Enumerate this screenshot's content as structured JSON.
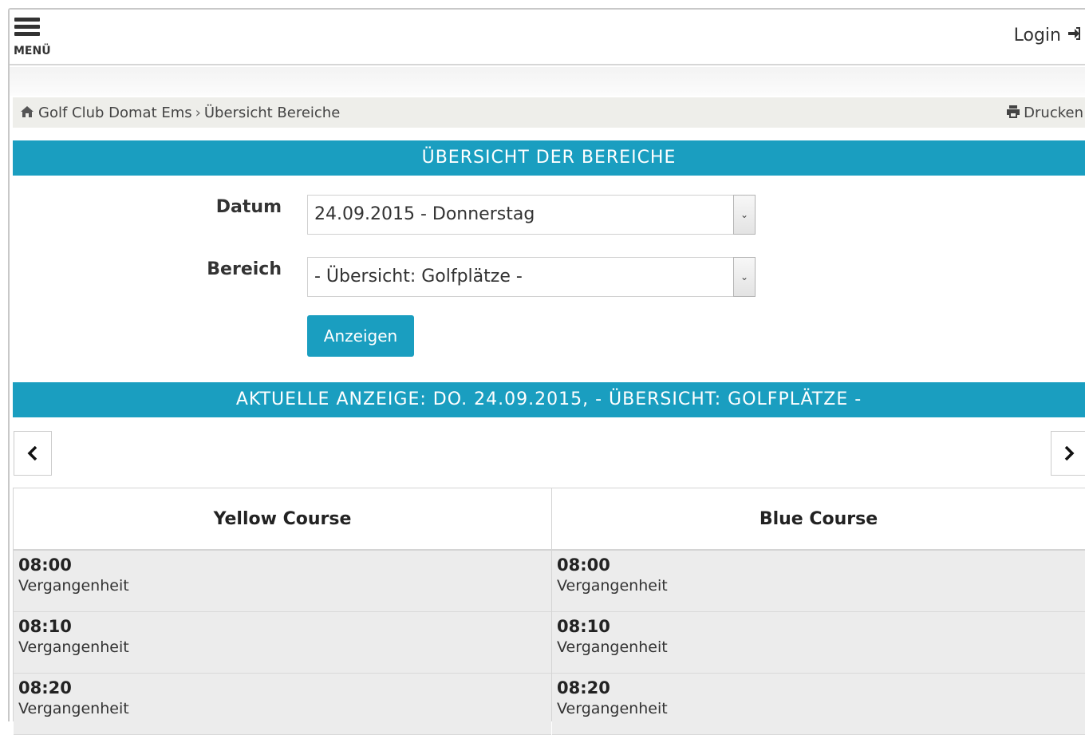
{
  "topbar": {
    "menu_label": "MENÜ",
    "login_label": "Login",
    "login_icon": "➜"
  },
  "breadcrumb": {
    "home": "Golf Club Domat Ems",
    "separator": "›",
    "current": "Übersicht Bereiche",
    "print_label": "Drucken"
  },
  "overview": {
    "header": "ÜBERSICHT DER BEREICHE",
    "date_label": "Datum",
    "date_value": "24.09.2015 - Donnerstag",
    "area_label": "Bereich",
    "area_value": "- Übersicht: Golfplätze -",
    "show_button": "Anzeigen"
  },
  "current_display": {
    "header": "AKTUELLE ANZEIGE: DO. 24.09.2015, - ÜBERSICHT: GOLFPLÄTZE -",
    "prev": "‹",
    "next": "›"
  },
  "courses": [
    {
      "name": "Yellow Course",
      "slots": [
        {
          "time": "08:00",
          "status": "Vergangenheit"
        },
        {
          "time": "08:10",
          "status": "Vergangenheit"
        },
        {
          "time": "08:20",
          "status": "Vergangenheit"
        }
      ]
    },
    {
      "name": "Blue Course",
      "slots": [
        {
          "time": "08:00",
          "status": "Vergangenheit"
        },
        {
          "time": "08:10",
          "status": "Vergangenheit"
        },
        {
          "time": "08:20",
          "status": "Vergangenheit"
        }
      ]
    }
  ],
  "colors": {
    "accent": "#1a9ec0",
    "breadcrumb_bg": "#eeeeea",
    "slot_bg": "#ececec"
  }
}
